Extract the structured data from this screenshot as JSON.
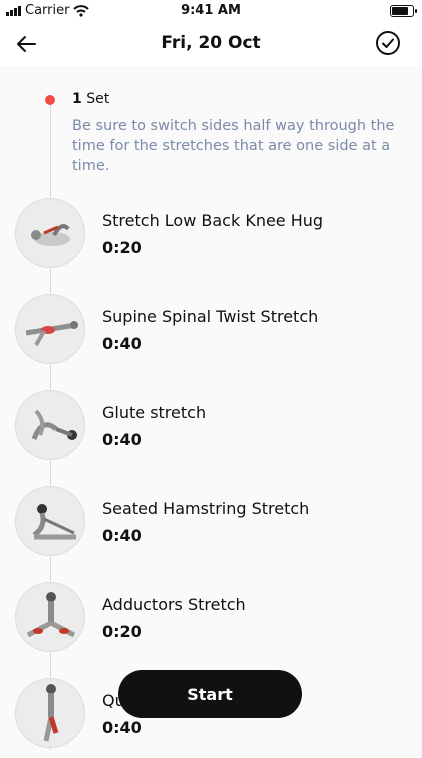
{
  "status": {
    "carrier": "Carrier",
    "time": "9:41 AM",
    "battery_level": 0.9
  },
  "header": {
    "title": "Fri, 20 Oct",
    "back_icon": "arrow-left-icon",
    "done_icon": "check-circle-icon"
  },
  "section": {
    "set_count": "1",
    "set_word": "Set",
    "note": "Be sure to switch sides half way through the time for the stretches that are one side at a time."
  },
  "exercises": [
    {
      "name": "Stretch Low Back Knee Hug",
      "duration": "0:20"
    },
    {
      "name": "Supine Spinal Twist Stretch",
      "duration": "0:40"
    },
    {
      "name": "Glute stretch",
      "duration": "0:40"
    },
    {
      "name": "Seated Hamstring Stretch",
      "duration": "0:40"
    },
    {
      "name": "Adductors Stretch",
      "duration": "0:20"
    },
    {
      "name": "Qu",
      "duration": "0:40"
    }
  ],
  "start_button": {
    "label": "Start"
  },
  "colors": {
    "accent_dot": "#ef4d44",
    "note_text": "#7a8aa8",
    "button": "#111111"
  }
}
